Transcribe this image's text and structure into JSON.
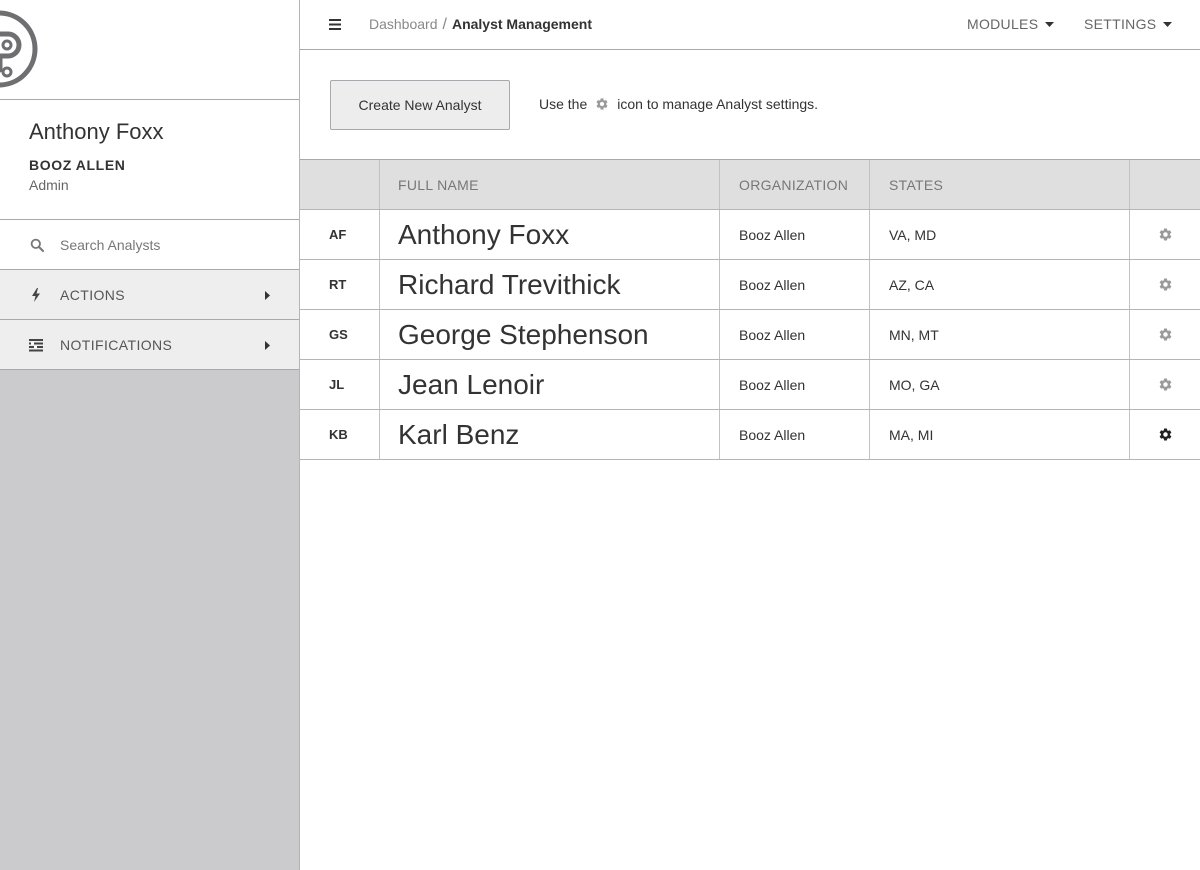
{
  "sidebar": {
    "profile": {
      "name": "Anthony Foxx",
      "organization": "BOOZ ALLEN",
      "role": "Admin"
    },
    "search": {
      "placeholder": "Search Analysts",
      "value": ""
    },
    "nav": [
      {
        "label": "ACTIONS",
        "icon": "bolt-icon"
      },
      {
        "label": "NOTIFICATIONS",
        "icon": "list-icon"
      }
    ]
  },
  "header": {
    "breadcrumb": {
      "link": "Dashboard",
      "separator": "/",
      "current": "Analyst Management"
    },
    "menus": [
      {
        "label": "MODULES"
      },
      {
        "label": "SETTINGS"
      }
    ]
  },
  "toolbar": {
    "create_label": "Create New Analyst",
    "hint_before": "Use the",
    "hint_after": "icon to manage Analyst settings."
  },
  "table": {
    "columns": [
      "",
      "FULL NAME",
      "ORGANIZATION",
      "STATES",
      ""
    ],
    "rows": [
      {
        "initials": "AF",
        "name": "Anthony Foxx",
        "organization": "Booz Allen",
        "states": "VA, MD",
        "gear_active": false
      },
      {
        "initials": "RT",
        "name": "Richard Trevithick",
        "organization": "Booz Allen",
        "states": "AZ, CA",
        "gear_active": false
      },
      {
        "initials": "GS",
        "name": "George Stephenson",
        "organization": "Booz Allen",
        "states": "MN, MT",
        "gear_active": false
      },
      {
        "initials": "JL",
        "name": "Jean Lenoir",
        "organization": "Booz Allen",
        "states": "MO, GA",
        "gear_active": false
      },
      {
        "initials": "KB",
        "name": "Karl Benz",
        "organization": "Booz Allen",
        "states": "MA, MI",
        "gear_active": true
      }
    ]
  },
  "colors": {
    "sidebar_bg": "#cbcbcd",
    "header_row_bg": "#dfdfe0",
    "gear_inactive": "#9a9a9d",
    "gear_active": "#222222",
    "text": "#333333"
  }
}
